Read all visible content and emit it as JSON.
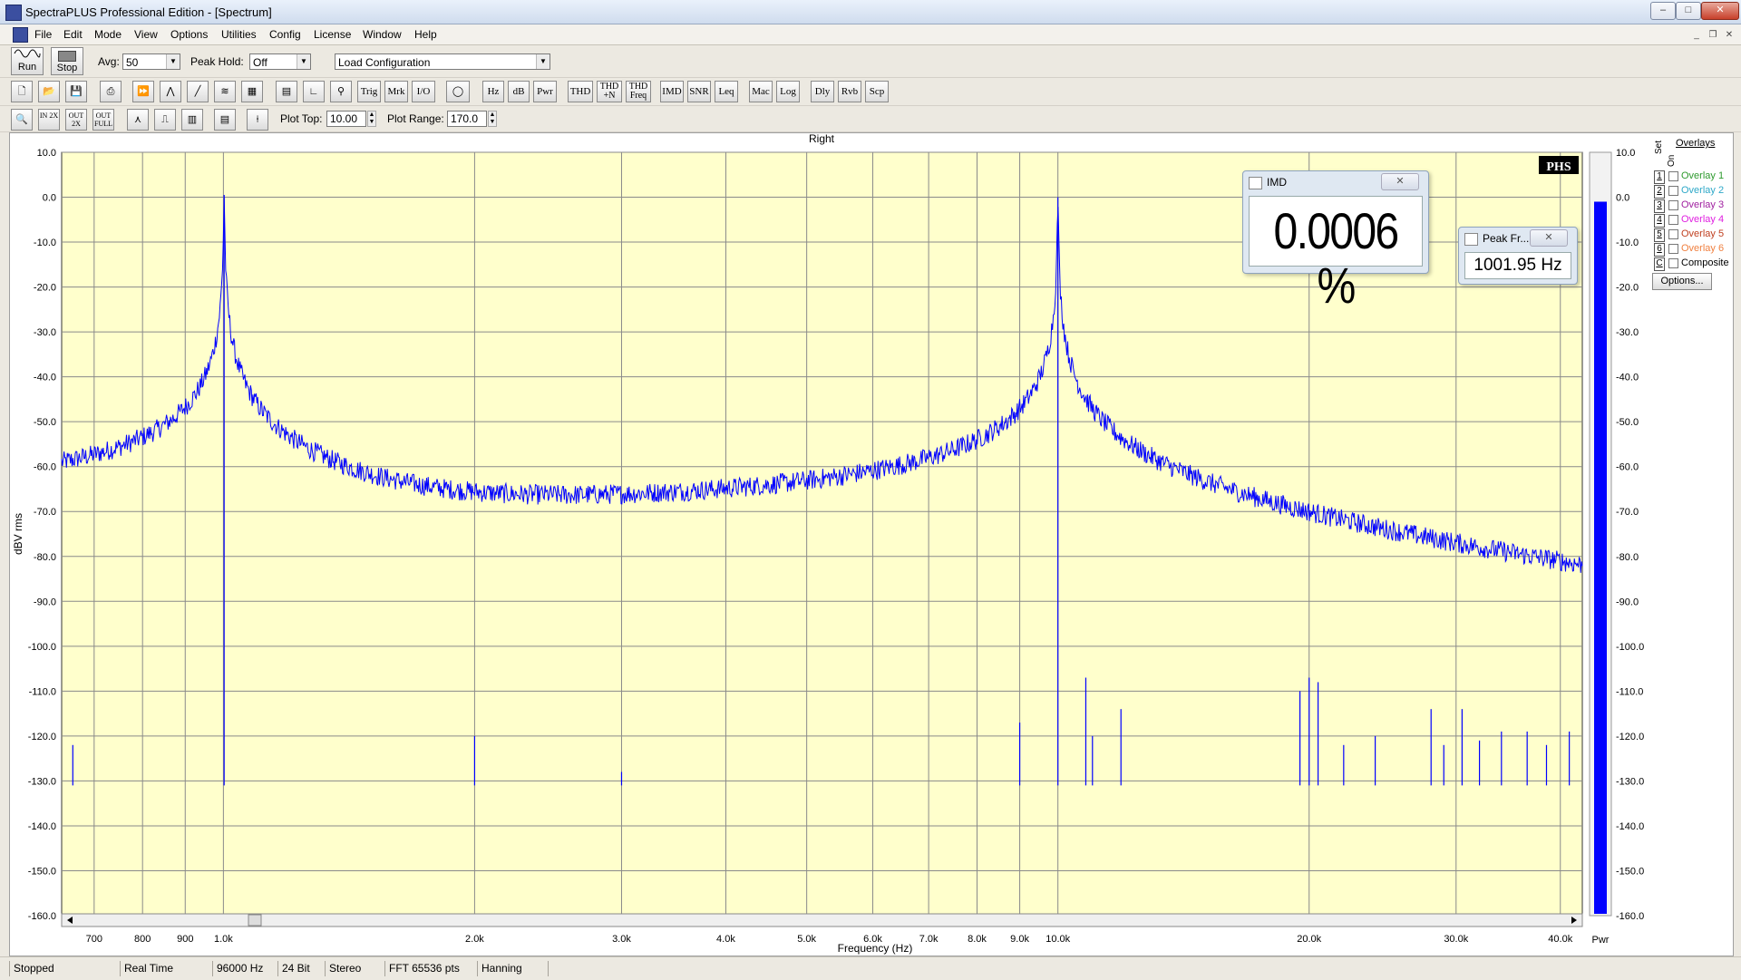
{
  "window": {
    "title": "SpectraPLUS Professional Edition - [Spectrum]"
  },
  "menu": [
    "File",
    "Edit",
    "Mode",
    "View",
    "Options",
    "Utilities",
    "Config",
    "License",
    "Window",
    "Help"
  ],
  "toolbar1": {
    "run_label": "Run",
    "stop_label": "Stop",
    "avg_label": "Avg:",
    "avg_value": "50",
    "peakhold_label": "Peak Hold:",
    "peakhold_value": "Off",
    "config_value": "Load Configuration"
  },
  "toolbar2": {
    "buttons": [
      "Trig",
      "Mrk",
      "I/O",
      "Hz",
      "dB",
      "Pwr",
      "THD",
      "THD +N",
      "THD Freq",
      "IMD",
      "SNR",
      "Leq",
      "Mac",
      "Log",
      "Dly",
      "Rvb",
      "Scp"
    ]
  },
  "toolbar3": {
    "zoom_buttons": [
      "IN 2X",
      "OUT 2X",
      "OUT FULL"
    ],
    "plot_top_label": "Plot Top:",
    "plot_top_value": "10.00",
    "plot_range_label": "Plot Range:",
    "plot_range_value": "170.0"
  },
  "plot": {
    "channel_title": "Right",
    "badge": "PHS",
    "meter_label": "Pwr"
  },
  "chart_data": {
    "type": "line",
    "title": "Right",
    "xlabel": "Frequency (Hz)",
    "ylabel": "dBV rms",
    "x_scale": "log",
    "xlim": [
      640,
      42500
    ],
    "ylim": [
      -160,
      10
    ],
    "grid": true,
    "y_ticks": [
      "10.0",
      "0.0",
      "-10.0",
      "-20.0",
      "-30.0",
      "-40.0",
      "-50.0",
      "-60.0",
      "-70.0",
      "-80.0",
      "-90.0",
      "-100.0",
      "-110.0",
      "-120.0",
      "-130.0",
      "-140.0",
      "-150.0",
      "-160.0"
    ],
    "x_ticks": [
      {
        "value": 700,
        "label": "700"
      },
      {
        "value": 800,
        "label": "800"
      },
      {
        "value": 900,
        "label": "900"
      },
      {
        "value": 1000,
        "label": "1.0k"
      },
      {
        "value": 2000,
        "label": "2.0k"
      },
      {
        "value": 3000,
        "label": "3.0k"
      },
      {
        "value": 4000,
        "label": "4.0k"
      },
      {
        "value": 5000,
        "label": "5.0k"
      },
      {
        "value": 6000,
        "label": "6.0k"
      },
      {
        "value": 7000,
        "label": "7.0k"
      },
      {
        "value": 8000,
        "label": "8.0k"
      },
      {
        "value": 9000,
        "label": "9.0k"
      },
      {
        "value": 10000,
        "label": "10.0k"
      },
      {
        "value": 20000,
        "label": "20.0k"
      },
      {
        "value": 30000,
        "label": "30.0k"
      },
      {
        "value": 40000,
        "label": "40.0k"
      }
    ],
    "series": [
      {
        "color": "#0000ff",
        "noise_floor": -131,
        "peaks": [
          {
            "x": 1002,
            "y": 0.5
          },
          {
            "x": 10000,
            "y": 0
          },
          {
            "x": 660,
            "y": -122
          },
          {
            "x": 2000,
            "y": -120
          },
          {
            "x": 3000,
            "y": -128
          },
          {
            "x": 9000,
            "y": -117
          },
          {
            "x": 10800,
            "y": -107
          },
          {
            "x": 11000,
            "y": -120
          },
          {
            "x": 11900,
            "y": -114
          },
          {
            "x": 19500,
            "y": -110
          },
          {
            "x": 20000,
            "y": -107
          },
          {
            "x": 20500,
            "y": -108
          },
          {
            "x": 22000,
            "y": -122
          },
          {
            "x": 24000,
            "y": -120
          },
          {
            "x": 28000,
            "y": -114
          },
          {
            "x": 29000,
            "y": -122
          },
          {
            "x": 30500,
            "y": -114
          },
          {
            "x": 32000,
            "y": -121
          },
          {
            "x": 34000,
            "y": -119
          },
          {
            "x": 36500,
            "y": -119
          },
          {
            "x": 38500,
            "y": -122
          },
          {
            "x": 41000,
            "y": -119
          }
        ]
      }
    ],
    "power_meter": {
      "color": "#0000ff",
      "level_db": -1
    }
  },
  "imd_window": {
    "title": "IMD",
    "value": "0.0006 %"
  },
  "peak_window": {
    "title": "Peak Fr...",
    "value": "1001.95 Hz"
  },
  "overlays": {
    "title": "Overlays",
    "set_label": "Set",
    "on_label": "On",
    "items": [
      {
        "num": "1",
        "name": "Overlay 1",
        "color": "#2e9a2e"
      },
      {
        "num": "2",
        "name": "Overlay 2",
        "color": "#2ea8c8"
      },
      {
        "num": "3",
        "name": "Overlay 3",
        "color": "#a020a0"
      },
      {
        "num": "4",
        "name": "Overlay 4",
        "color": "#e020e0"
      },
      {
        "num": "5",
        "name": "Overlay 5",
        "color": "#c04020"
      },
      {
        "num": "6",
        "name": "Overlay 6",
        "color": "#f08040"
      },
      {
        "num": "C",
        "name": "Composite",
        "color": "#000000"
      }
    ],
    "options_label": "Options..."
  },
  "status": [
    "Stopped",
    "Real Time",
    "96000 Hz",
    "24 Bit",
    "Stereo",
    "FFT 65536 pts",
    "Hanning"
  ]
}
